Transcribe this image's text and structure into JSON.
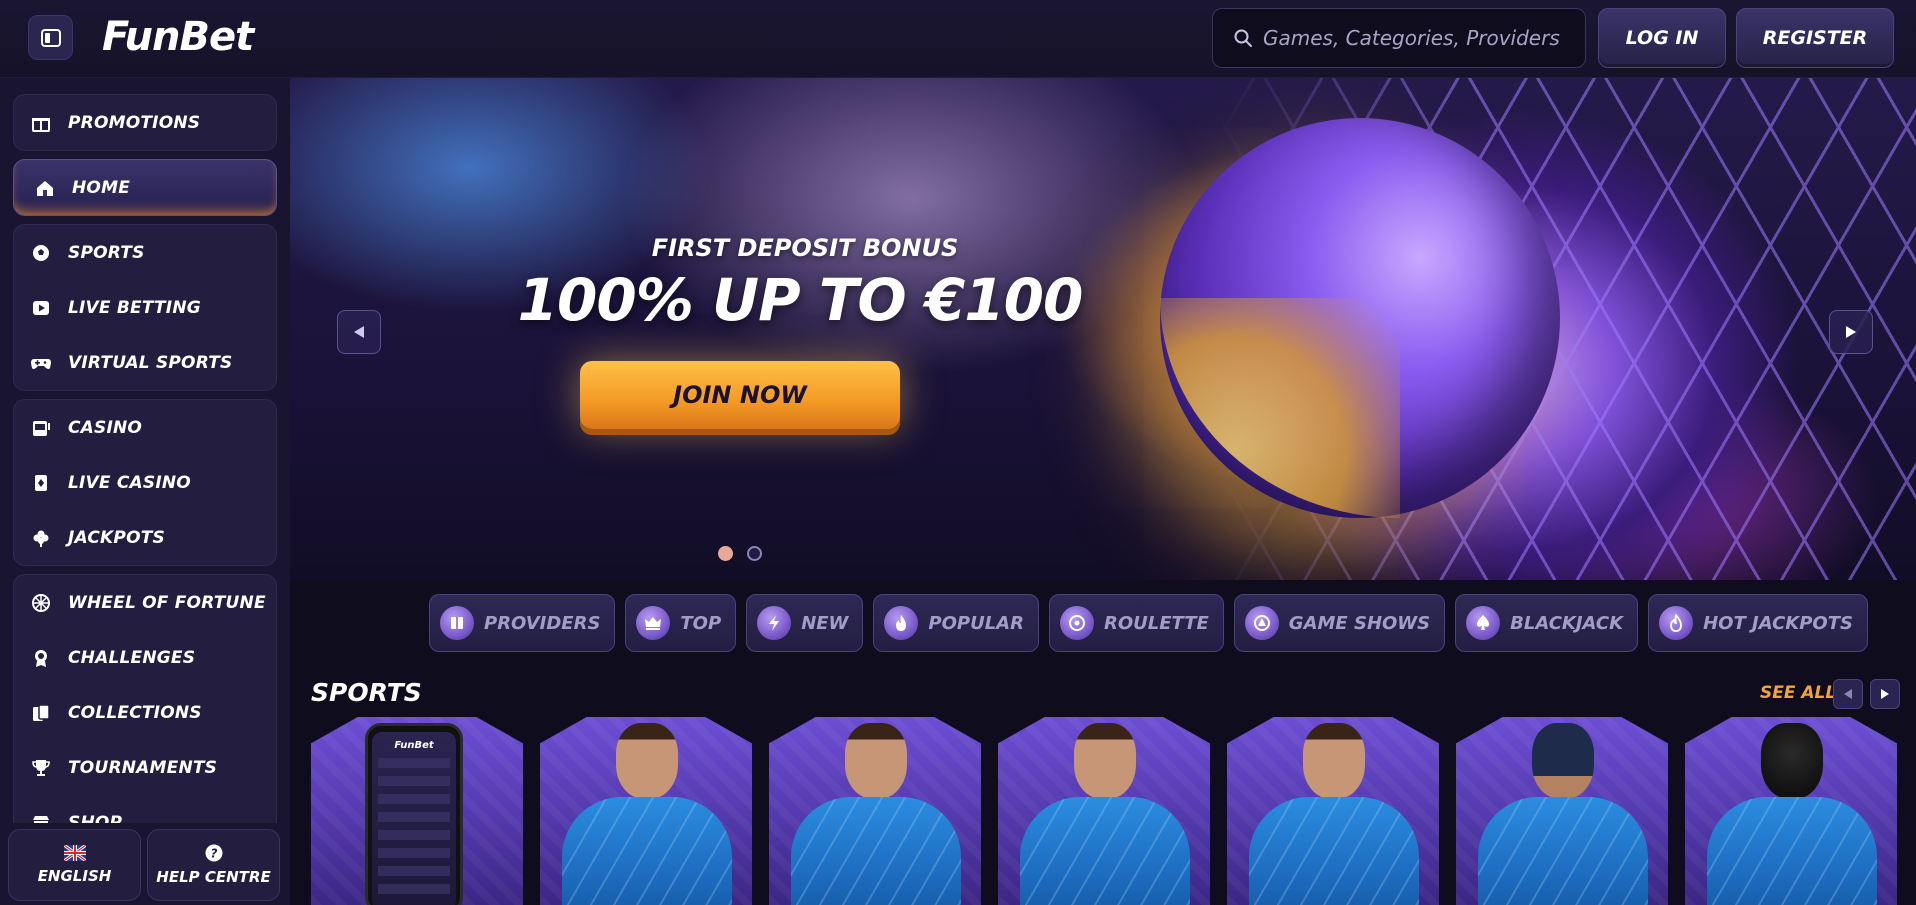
{
  "header": {
    "logo": "FunBet",
    "search_placeholder": "Games, Categories, Providers",
    "login_label": "LOG IN",
    "register_label": "REGISTER"
  },
  "sidebar": {
    "group1": [
      {
        "label": "PROMOTIONS",
        "icon": "gift-icon"
      }
    ],
    "home": {
      "label": "HOME",
      "icon": "house-icon"
    },
    "group2": [
      {
        "label": "SPORTS",
        "icon": "soccer-ball-icon"
      },
      {
        "label": "LIVE BETTING",
        "icon": "play-icon"
      },
      {
        "label": "VIRTUAL SPORTS",
        "icon": "gamepad-icon"
      }
    ],
    "group3": [
      {
        "label": "CASINO",
        "icon": "slot-machine-icon"
      },
      {
        "label": "LIVE CASINO",
        "icon": "cards-icon"
      },
      {
        "label": "JACKPOTS",
        "icon": "clover-icon"
      }
    ],
    "group4": [
      {
        "label": "WHEEL OF FORTUNE",
        "icon": "wheel-icon"
      },
      {
        "label": "CHALLENGES",
        "icon": "medal-icon"
      },
      {
        "label": "COLLECTIONS",
        "icon": "cards-stack-icon"
      },
      {
        "label": "TOURNAMENTS",
        "icon": "trophy-icon"
      },
      {
        "label": "SHOP",
        "icon": "shop-icon"
      }
    ],
    "footer": {
      "language": "ENGLISH",
      "help": "HELP CENTRE"
    }
  },
  "hero": {
    "subtitle": "FIRST DEPOSIT BONUS",
    "title": "100% UP TO €100",
    "cta": "JOIN NOW",
    "slides": 2,
    "active_slide": 1
  },
  "categories": [
    {
      "label": "PROVIDERS",
      "icon": "book-icon"
    },
    {
      "label": "TOP",
      "icon": "crown-icon"
    },
    {
      "label": "NEW",
      "icon": "lightning-icon"
    },
    {
      "label": "POPULAR",
      "icon": "flame-icon"
    },
    {
      "label": "ROULETTE",
      "icon": "roulette-icon"
    },
    {
      "label": "GAME SHOWS",
      "icon": "stage-icon"
    },
    {
      "label": "BLACKJACK",
      "icon": "spade-icon"
    },
    {
      "label": "HOT JACKPOTS",
      "icon": "hot-flame-icon"
    }
  ],
  "sports": {
    "title": "SPORTS",
    "see_all": "SEE ALL",
    "cards": [
      {
        "name": "app-card",
        "phone_title": "FunBet"
      },
      {
        "name": "football-player-card"
      },
      {
        "name": "tennis-player-card"
      },
      {
        "name": "table-tennis-player-card"
      },
      {
        "name": "basketball-player-card"
      },
      {
        "name": "hockey-player-card"
      },
      {
        "name": "american-football-player-card"
      }
    ]
  },
  "colors": {
    "background": "#0f0c1e",
    "sidebar": "#191530",
    "accent_orange": "#f2a43a",
    "purple_accent": "#7b5acb"
  }
}
